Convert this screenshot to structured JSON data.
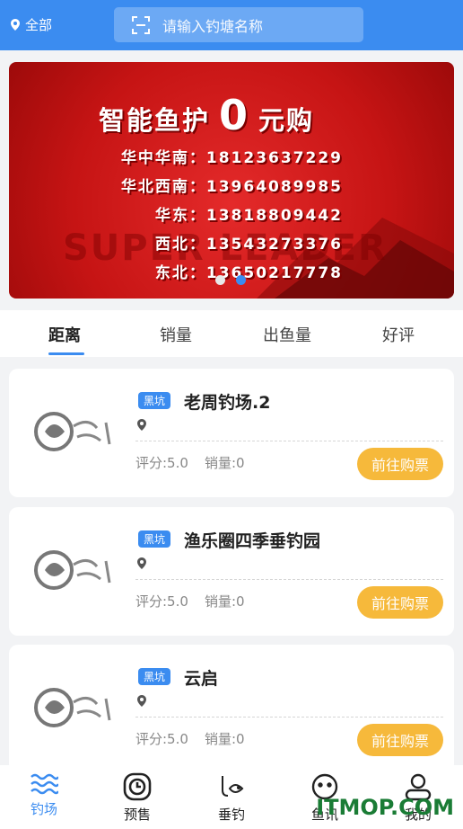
{
  "header": {
    "location_label": "全部",
    "search_placeholder": "请输入钓塘名称"
  },
  "banner": {
    "title_prefix": "智能鱼护",
    "title_number": "0",
    "title_suffix": "元购",
    "contacts": [
      "华中华南：18123637229",
      "华北西南：13964089985",
      "华东：13818809442",
      "西北：13543273376",
      "东北：13650217778"
    ],
    "watermark": "SUPER LEADER",
    "active_dot": 2
  },
  "tabs": [
    "距离",
    "销量",
    "出鱼量",
    "好评"
  ],
  "active_tab": 0,
  "cards": [
    {
      "badge": "黑坑",
      "name": "老周钓场.2",
      "score": "评分:5.0",
      "sales": "销量:0",
      "button": "前往购票"
    },
    {
      "badge": "黑坑",
      "name": "渔乐圈四季垂钓园",
      "score": "评分:5.0",
      "sales": "销量:0",
      "button": "前往购票"
    },
    {
      "badge": "黑坑",
      "name": "云启",
      "score": "评分:5.0",
      "sales": "销量:0",
      "button": "前往购票"
    }
  ],
  "nav": [
    "钓场",
    "预售",
    "垂钓",
    "鱼讯",
    "我的"
  ],
  "watermark_brand": "ITMOP.COM",
  "colors": {
    "primary": "#3b8cf0",
    "button": "#f6b93b",
    "banner_red": "#c61414"
  }
}
